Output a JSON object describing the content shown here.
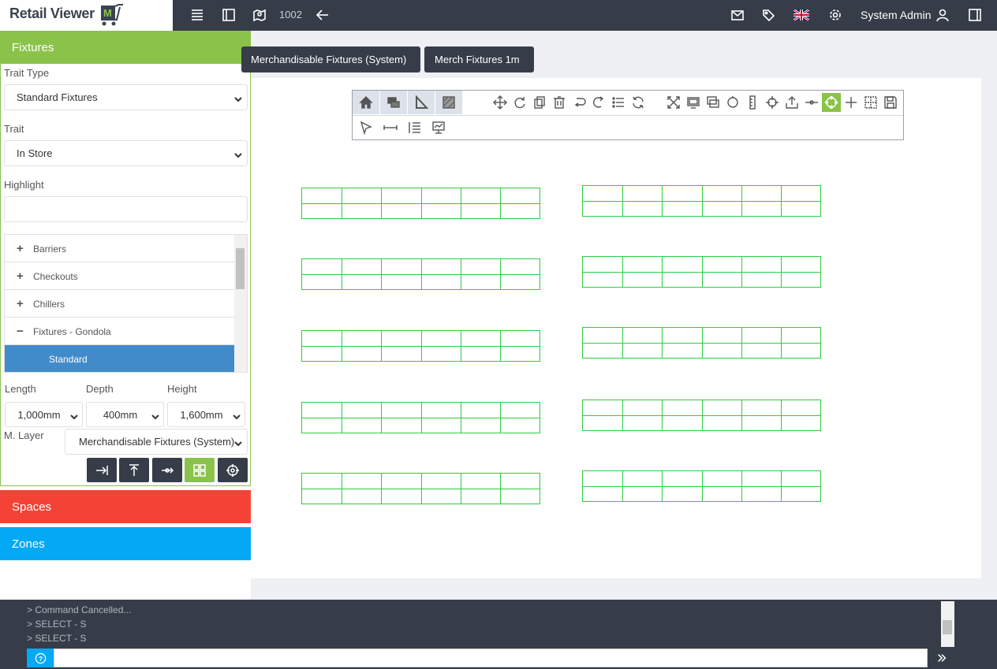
{
  "app": {
    "logo_text": "Retail Viewer",
    "store_number": "1002",
    "user_name": "System Admin"
  },
  "sidebar": {
    "fixtures_title": "Fixtures",
    "trait_type_label": "Trait Type",
    "trait_type_value": "Standard Fixtures",
    "trait_label": "Trait",
    "trait_value": "In Store",
    "highlight_label": "Highlight",
    "highlight_value": "",
    "tree": [
      {
        "sign": "+",
        "label": "Barriers"
      },
      {
        "sign": "+",
        "label": "Checkouts"
      },
      {
        "sign": "+",
        "label": "Chillers"
      },
      {
        "sign": "−",
        "label": "Fixtures - Gondola"
      },
      {
        "sign": "",
        "label": "Standard"
      }
    ],
    "length_label": "Length",
    "depth_label": "Depth",
    "height_label": "Height",
    "length_value": "1,000mm",
    "depth_value": "400mm",
    "height_value": "1,600mm",
    "mlayer_label": "M. Layer",
    "mlayer_value": "Merchandisable Fixtures (System)",
    "spaces_title": "Spaces",
    "zones_title": "Zones"
  },
  "main": {
    "tabs": [
      "Merchandisable Fixtures (System)",
      "Merch Fixtures 1m"
    ]
  },
  "console": {
    "lines": [
      "> Command Cancelled...",
      "> SELECT - S",
      "> SELECT - S"
    ],
    "input_value": ""
  },
  "colors": {
    "fixtures": "#8bc34a",
    "spaces": "#f44336",
    "zones": "#03a9f4",
    "selected": "#428bca",
    "fixture_stroke": "#2ecc40"
  }
}
